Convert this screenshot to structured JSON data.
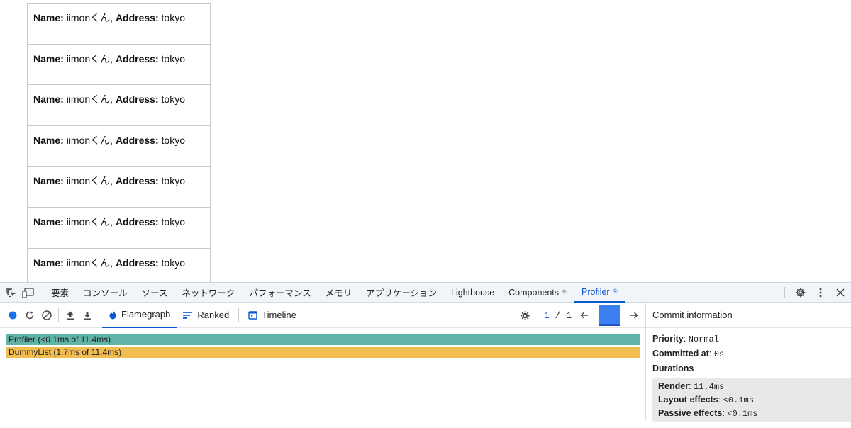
{
  "page": {
    "rows": [
      {
        "name_label": "Name:",
        "name_value": "iimonくん,",
        "address_label": "Address:",
        "address_value": "tokyo"
      },
      {
        "name_label": "Name:",
        "name_value": "iimonくん,",
        "address_label": "Address:",
        "address_value": "tokyo"
      },
      {
        "name_label": "Name:",
        "name_value": "iimonくん,",
        "address_label": "Address:",
        "address_value": "tokyo"
      },
      {
        "name_label": "Name:",
        "name_value": "iimonくん,",
        "address_label": "Address:",
        "address_value": "tokyo"
      },
      {
        "name_label": "Name:",
        "name_value": "iimonくん,",
        "address_label": "Address:",
        "address_value": "tokyo"
      },
      {
        "name_label": "Name:",
        "name_value": "iimonくん,",
        "address_label": "Address:",
        "address_value": "tokyo"
      },
      {
        "name_label": "Name:",
        "name_value": "iimonくん,",
        "address_label": "Address:",
        "address_value": "tokyo"
      }
    ]
  },
  "devtools": {
    "tabs": [
      {
        "label": "要素"
      },
      {
        "label": "コンソール"
      },
      {
        "label": "ソース"
      },
      {
        "label": "ネットワーク"
      },
      {
        "label": "パフォーマンス"
      },
      {
        "label": "メモリ"
      },
      {
        "label": "アプリケーション"
      },
      {
        "label": "Lighthouse"
      },
      {
        "label": "Components",
        "dot": "⚛"
      },
      {
        "label": "Profiler",
        "dot": "⚛"
      }
    ],
    "profiler": {
      "views": [
        {
          "label": "Flamegraph"
        },
        {
          "label": "Ranked"
        },
        {
          "label": "Timeline"
        }
      ],
      "commit_current": "1",
      "commit_separator": "/",
      "commit_total": "1",
      "flame_bars": [
        {
          "label": "Profiler (<0.1ms of 11.4ms)",
          "color": "#5fb3a7"
        },
        {
          "label": "DummyList (1.7ms of 11.4ms)",
          "color": "#f1bd51"
        }
      ]
    },
    "commit_info": {
      "title": "Commit information",
      "priority_label": "Priority",
      "priority_value": "Normal",
      "committed_label": "Committed at",
      "committed_value": "0s",
      "durations_label": "Durations",
      "render_label": "Render",
      "render_value": "11.4ms",
      "layout_label": "Layout effects",
      "layout_value": "<0.1ms",
      "passive_label": "Passive effects",
      "passive_value": "<0.1ms"
    }
  },
  "colors": {
    "accent": "#0b57d0",
    "record": "#1a73e8"
  }
}
